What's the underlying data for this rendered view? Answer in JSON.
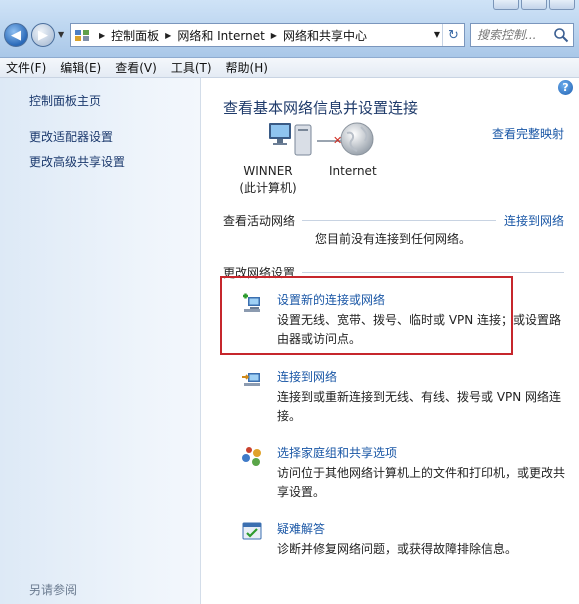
{
  "address": {
    "crumbs": [
      "控制面板",
      "网络和 Internet",
      "网络和共享中心"
    ]
  },
  "search": {
    "placeholder": "搜索控制..."
  },
  "menu": [
    "文件(F)",
    "编辑(E)",
    "查看(V)",
    "工具(T)",
    "帮助(H)"
  ],
  "sidebar": {
    "home": "控制面板主页",
    "links": [
      "更改适配器设置",
      "更改高级共享设置"
    ],
    "see_also": "另请参阅"
  },
  "main": {
    "title": "查看基本网络信息并设置连接",
    "full_map": "查看完整映射",
    "computer_name": "WINNER",
    "computer_sub": "(此计算机)",
    "internet": "Internet",
    "active_networks_title": "查看活动网络",
    "connect_link": "连接到网络",
    "no_connection": "您目前没有连接到任何网络。",
    "change_settings_title": "更改网络设置",
    "tasks": [
      {
        "icon": "new-connection-icon",
        "title": "设置新的连接或网络",
        "desc": "设置无线、宽带、拨号、临时或 VPN 连接；或设置路由器或访问点。"
      },
      {
        "icon": "connect-network-icon",
        "title": "连接到网络",
        "desc": "连接到或重新连接到无线、有线、拨号或 VPN 网络连接。"
      },
      {
        "icon": "homegroup-icon",
        "title": "选择家庭组和共享选项",
        "desc": "访问位于其他网络计算机上的文件和打印机，或更改共享设置。"
      },
      {
        "icon": "troubleshoot-icon",
        "title": "疑难解答",
        "desc": "诊断并修复网络问题，或获得故障排除信息。"
      }
    ]
  },
  "colors": {
    "link": "#1a57a6",
    "highlight_box": "#c6262c"
  }
}
